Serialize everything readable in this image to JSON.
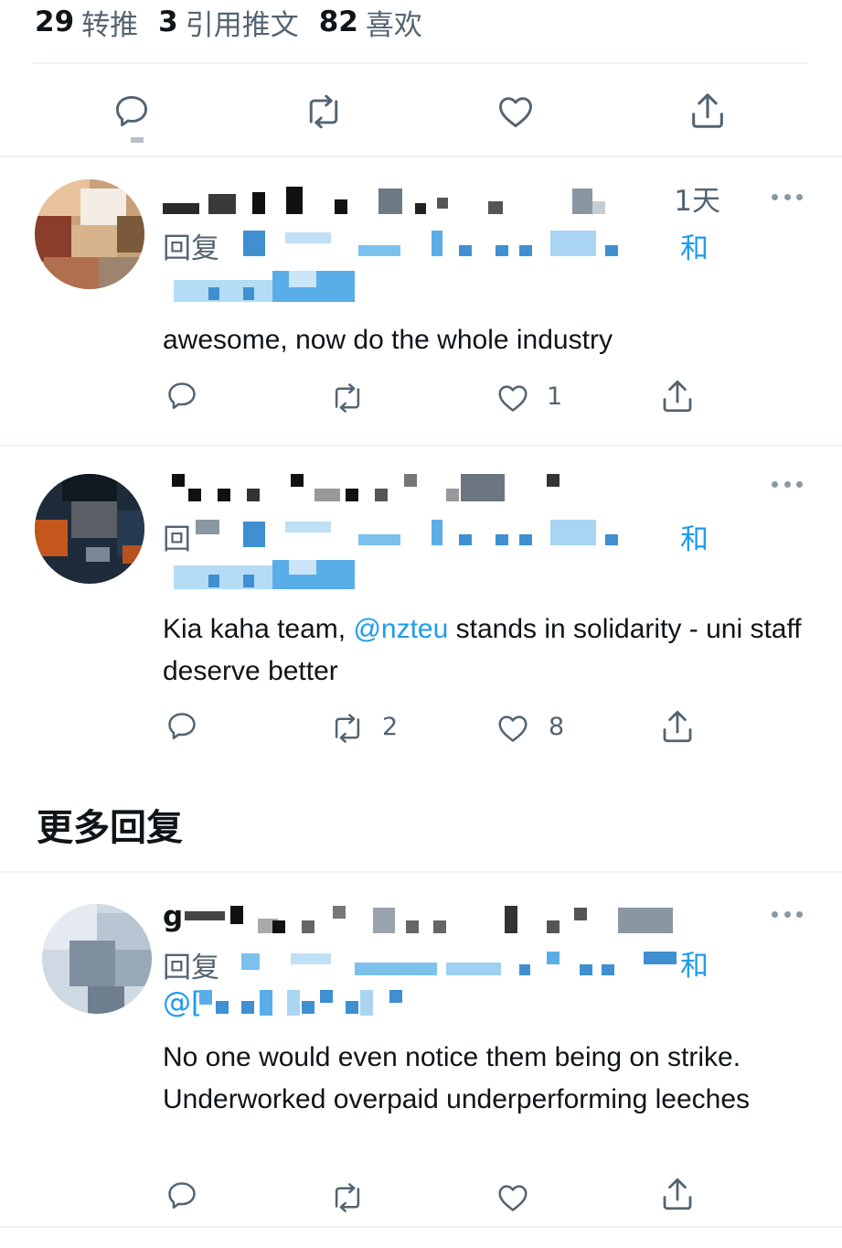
{
  "stats": {
    "retweets_count": "29",
    "retweets_label": "转推",
    "quotes_count": "3",
    "quotes_label": "引用推文",
    "likes_count": "82",
    "likes_label": "喜欢"
  },
  "action_icons": [
    "reply-icon",
    "retweet-icon",
    "like-icon",
    "share-icon"
  ],
  "colors": {
    "accent": "#1d9bf0",
    "secondary_text": "#536471",
    "divider": "#eff3f4"
  },
  "replies": [
    {
      "time": "1天",
      "reply_prefix": "回复",
      "and_text": "和",
      "text": "awesome, now do the whole industry",
      "retweet_count": "",
      "like_count": "1"
    },
    {
      "reply_prefix": "回",
      "and_text": "和",
      "text_before": "Kia kaha team, ",
      "mention": "@nzteu",
      "text_after": " stands in solidarity - uni staff deserve better",
      "retweet_count": "2",
      "like_count": "8"
    }
  ],
  "more_replies": {
    "title": "更多回复",
    "items": [
      {
        "name_initial": "g",
        "reply_prefix": "回复",
        "and_text": "和",
        "handle_prefix": "@[",
        "text": "No one would even notice them being on strike. Underworked overpaid underperforming leeches",
        "retweet_count": "",
        "like_count": ""
      }
    ]
  }
}
